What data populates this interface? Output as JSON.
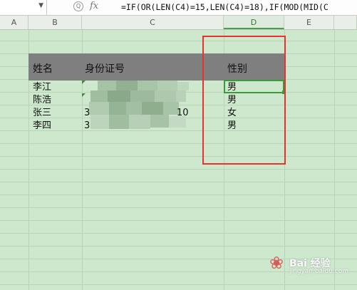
{
  "formula_bar": {
    "namebox_value": "",
    "fx_label": "fx",
    "zoom_glyph": "Q",
    "formula": "=IF(OR(LEN(C4)=15,LEN(C4)=18),IF(MOD(MID(C"
  },
  "columns": [
    "A",
    "B",
    "C",
    "D",
    "E"
  ],
  "active_column": "D",
  "table": {
    "headers": {
      "name": "姓名",
      "id": "身份证号",
      "gender": "性别"
    },
    "rows": [
      {
        "name": "李江",
        "id_visible": "",
        "gender": "男"
      },
      {
        "name": "陈浩",
        "id_visible": "",
        "gender": "男"
      },
      {
        "name": "张三",
        "id_visible": "3",
        "id_end": "10",
        "gender": "女"
      },
      {
        "name": "李四",
        "id_visible": "3",
        "gender": "男"
      }
    ]
  },
  "watermark": {
    "brand": "Bai 经验",
    "sub": "jingyan.baidu.com"
  },
  "colors": {
    "sheet_bg": "#cde8cd",
    "header_band": "#7f7f7f",
    "selection": "#3c9a3c",
    "annotation": "#e8322e"
  }
}
